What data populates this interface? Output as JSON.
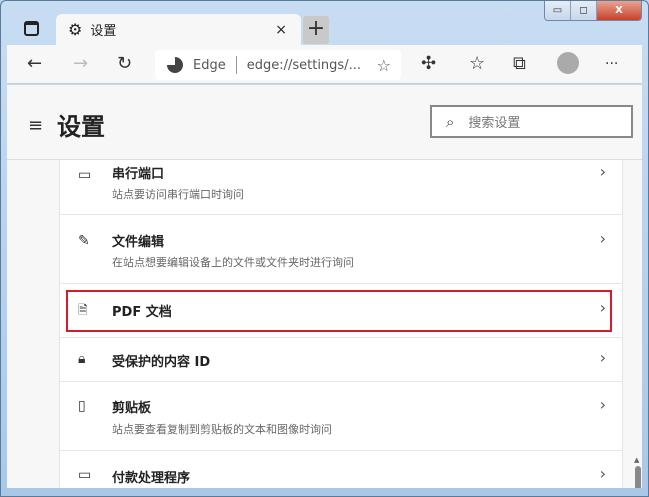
{
  "window": {
    "minimize": "▭",
    "maximize": "◻",
    "close": "X"
  },
  "tab": {
    "title": "设置",
    "close": "×",
    "new_tab": "+"
  },
  "toolbar": {
    "site_name": "Edge",
    "url": "edge://settings/...",
    "more": "···"
  },
  "header": {
    "title": "设置",
    "search_placeholder": "搜索设置"
  },
  "rows": [
    {
      "title": "串行端口",
      "subtitle": "站点要访问串行端口时询问",
      "icon": "serial-port-icon"
    },
    {
      "title": "文件编辑",
      "subtitle": "在站点想要编辑设备上的文件或文件夹时进行询问",
      "icon": "file-edit-icon"
    },
    {
      "title": "PDF 文档",
      "subtitle": "",
      "icon": "pdf-icon",
      "highlighted": true
    },
    {
      "title": "受保护的内容 ID",
      "subtitle": "",
      "icon": "lock-icon"
    },
    {
      "title": "剪贴板",
      "subtitle": "站点要查看复制到剪贴板的文本和图像时询问",
      "icon": "clipboard-icon"
    },
    {
      "title": "付款处理程序",
      "subtitle": "",
      "icon": "card-icon"
    }
  ],
  "colors": {
    "highlight": "#d11d2a"
  }
}
